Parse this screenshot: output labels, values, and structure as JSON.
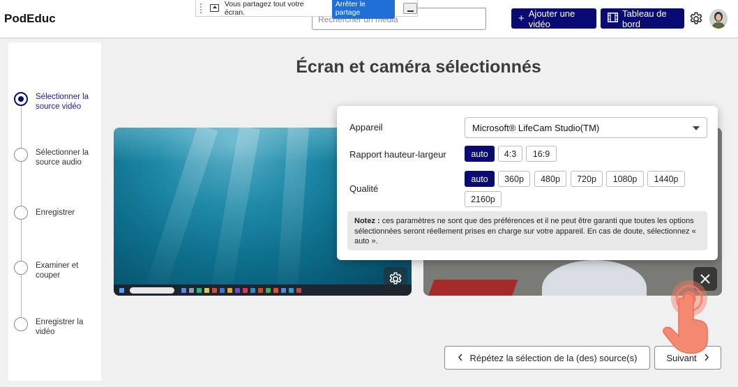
{
  "header": {
    "brand": "PodEduc",
    "search_placeholder": "Rechercher un média",
    "add_video_label": "Ajouter une vidéo",
    "dashboard_label": "Tableau de bord"
  },
  "share_toolbar": {
    "message": "Vous partagez tout votre écran.",
    "stop_label": "Arrêter le partage"
  },
  "steps": [
    {
      "label": "Sélectionner la source vidéo",
      "active": true
    },
    {
      "label": "Sélectionner la source audio",
      "active": false
    },
    {
      "label": "Enregistrer",
      "active": false
    },
    {
      "label": "Examiner et couper",
      "active": false
    },
    {
      "label": "Enregistrer la vidéo",
      "active": false
    }
  ],
  "main": {
    "title": "Écran et caméra sélectionnés"
  },
  "settings": {
    "device_label": "Appareil",
    "device_value": "Microsoft® LifeCam Studio(TM)",
    "ratio_label": "Rapport hauteur-largeur",
    "ratio_options": [
      "auto",
      "4:3",
      "16:9"
    ],
    "ratio_selected": "auto",
    "quality_label": "Qualité",
    "quality_options": [
      "auto",
      "360p",
      "480p",
      "720p",
      "1080p",
      "1440p",
      "2160p"
    ],
    "quality_selected": "auto",
    "note_bold": "Notez :",
    "note_text": " ces paramètres ne sont que des préférences et il ne peut être garanti que toutes les options sélectionnées seront réellement prises en charge sur votre appareil. En cas de doute, sélectionnez « auto »."
  },
  "footer": {
    "repeat_label": "Répétez la sélection de la (des) source(s)",
    "next_label": "Suivant"
  },
  "colors": {
    "primary": "#0a0a74",
    "active_step_text": "#1a1aa8",
    "share_stop": "#1f6fd6",
    "touch_indicator": "#f47b64"
  }
}
